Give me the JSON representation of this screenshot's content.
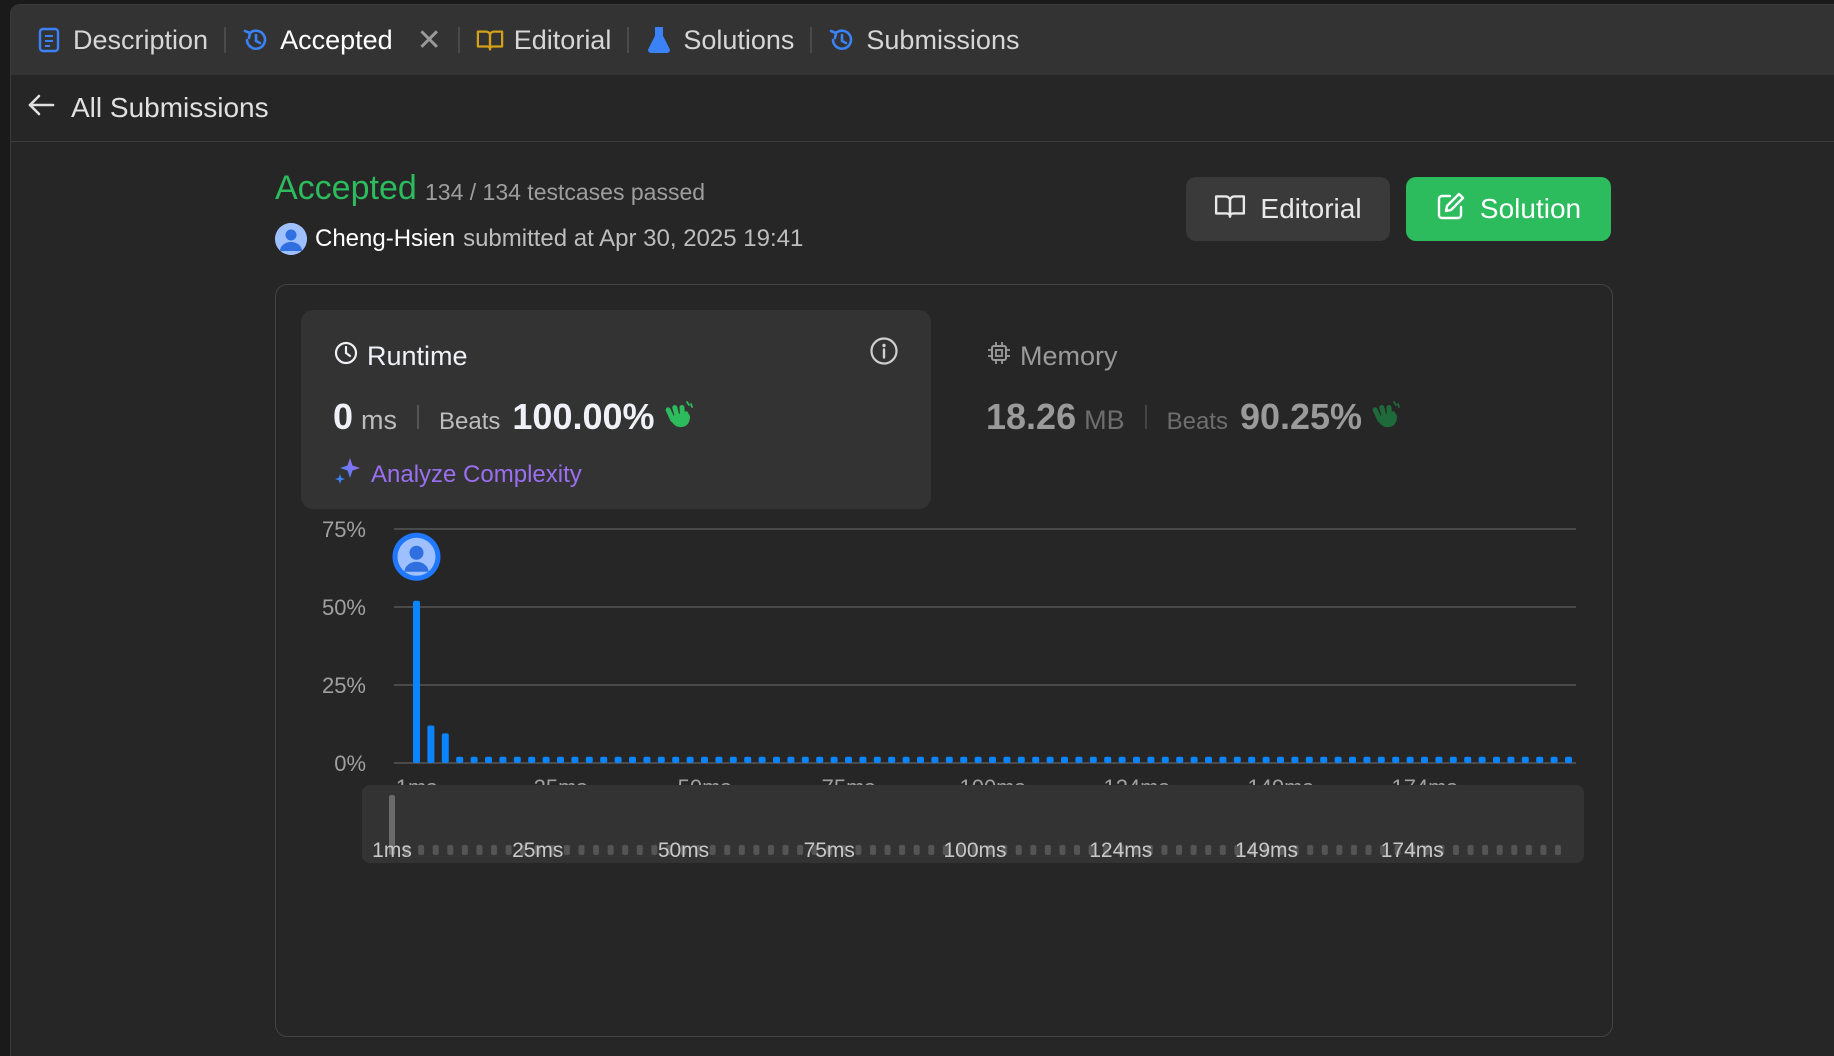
{
  "tabs": [
    {
      "label": "Description",
      "icon": "description-icon",
      "color": "#3b82f6"
    },
    {
      "label": "Accepted",
      "icon": "history-icon",
      "color": "#3b82f6",
      "active": true,
      "closable": true
    },
    {
      "label": "Editorial",
      "icon": "book-icon",
      "color": "#d4a017"
    },
    {
      "label": "Solutions",
      "icon": "flask-icon",
      "color": "#3b82f6"
    },
    {
      "label": "Submissions",
      "icon": "history-icon",
      "color": "#3b82f6"
    }
  ],
  "subheader": {
    "back_label": "All Submissions"
  },
  "submission": {
    "status": "Accepted",
    "testcases": "134 / 134 testcases passed",
    "author": "Cheng-Hsien",
    "submitted_text": "submitted at Apr 30, 2025 19:41"
  },
  "buttons": {
    "editorial": "Editorial",
    "solution": "Solution"
  },
  "runtime": {
    "title": "Runtime",
    "value": "0",
    "unit": "ms",
    "beats_label": "Beats",
    "beats_pct": "100.00%",
    "analyze_label": "Analyze Complexity"
  },
  "memory": {
    "title": "Memory",
    "value": "18.26",
    "unit": "MB",
    "beats_label": "Beats",
    "beats_pct": "90.25%"
  },
  "colors": {
    "accent_green": "#2cbb5d",
    "bar_blue": "#0a84ff",
    "analyze_purple": "#9a6ff0"
  },
  "chart_data": {
    "type": "bar",
    "title": "",
    "xlabel": "",
    "ylabel": "",
    "ylim": [
      0,
      75
    ],
    "y_ticks": [
      "75%",
      "50%",
      "25%",
      "0%"
    ],
    "y_tick_values": [
      75,
      50,
      25,
      0
    ],
    "x_tick_labels": [
      "1ms",
      "25ms",
      "50ms",
      "75ms",
      "100ms",
      "124ms",
      "149ms",
      "174ms"
    ],
    "x_tick_indices": [
      0,
      10,
      20,
      30,
      40,
      50,
      60,
      70
    ],
    "user_bin_index": 0,
    "series": [
      {
        "values": [
          52,
          12,
          9.5,
          2,
          2,
          2,
          2,
          2,
          2,
          2,
          2,
          2,
          2,
          2,
          2,
          2,
          2,
          2,
          2,
          2,
          2,
          2,
          2,
          2,
          2,
          2,
          2,
          2,
          2,
          2,
          2,
          2,
          2,
          2,
          2,
          2,
          2,
          2,
          2,
          2,
          2,
          2,
          2,
          2,
          2,
          2,
          2,
          2,
          2,
          2,
          2,
          2,
          2,
          2,
          2,
          2,
          2,
          2,
          2,
          2,
          2,
          2,
          2,
          2,
          2,
          2,
          2,
          2,
          2,
          2,
          2,
          2,
          2,
          2,
          2,
          2,
          2,
          2,
          2,
          2,
          2
        ]
      }
    ],
    "grid": true
  }
}
